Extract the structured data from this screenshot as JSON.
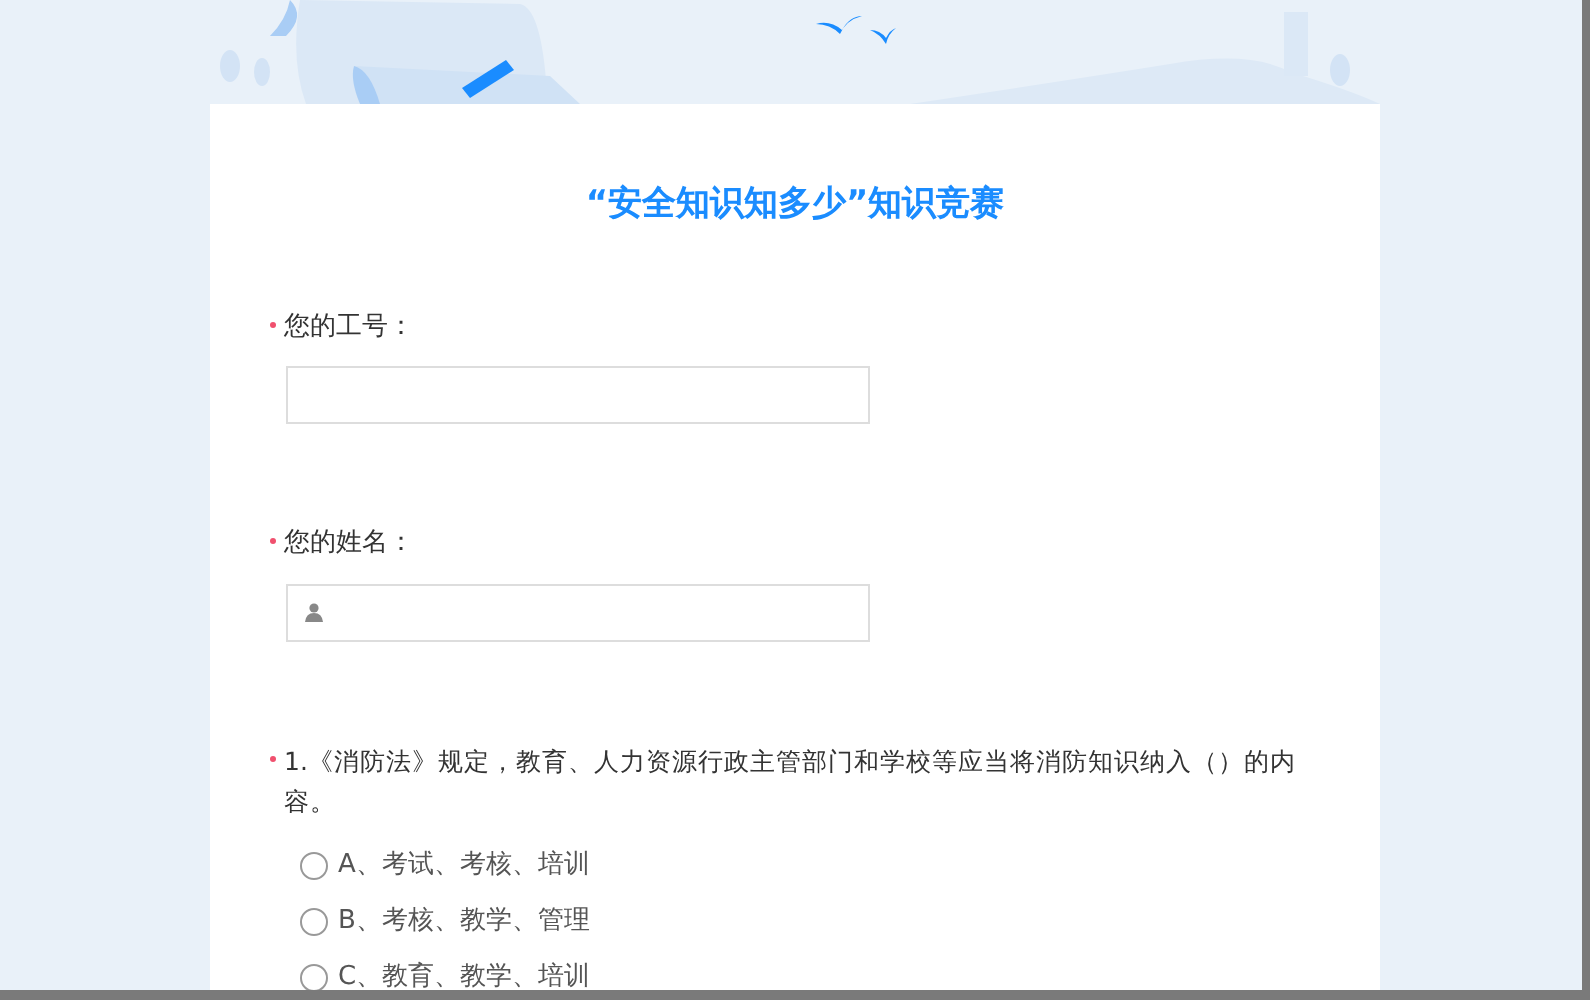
{
  "title": "“安全知识知多少”知识竞赛",
  "fields": [
    {
      "label": "您的工号：",
      "required": true,
      "kind": "plain"
    },
    {
      "label": "您的姓名：",
      "required": true,
      "kind": "user"
    }
  ],
  "questions": [
    {
      "text": "1.《消防法》规定，教育、人力资源行政主管部门和学校等应当将消防知识纳入（）的内容。",
      "required": true,
      "options": [
        {
          "label": "A、考试、考核、培训",
          "selected": false
        },
        {
          "label": "B、考核、教学、管理",
          "selected": false
        },
        {
          "label": "C、教育、教学、培训",
          "selected": false
        }
      ]
    }
  ]
}
